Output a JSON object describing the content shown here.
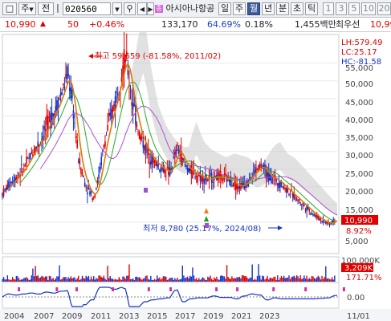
{
  "toolbar": {
    "mode_label": "주",
    "jeon_label": "전",
    "code_value": "020560",
    "stock_name": "아시아나항공",
    "periods": [
      "일",
      "주",
      "월",
      "년",
      "분",
      "초",
      "틱"
    ],
    "active_period": "월",
    "intervals": [
      "1",
      "3",
      "5",
      "10",
      "20"
    ]
  },
  "infobar": {
    "price": "10,990",
    "change": "50",
    "change_pct": "+0.46%",
    "volume": "133,170",
    "ratio": "64.69%",
    "turnover": "0.18%",
    "amount": "1,455백만",
    "best_label": "최우선",
    "best_value": "10,99"
  },
  "indicators": {
    "lh": "LH:579.49",
    "lc": "LC:25.17",
    "hc": "HC:-81.58"
  },
  "annotations": {
    "high": "최고 59,659 (-81.58%, 2011/02)",
    "low": "최저 8,780 (25.17%, 2024/08)"
  },
  "price_axis": {
    "labels": [
      "55,000",
      "50,000",
      "45,000",
      "40,000",
      "35,000",
      "30,000",
      "25,000",
      "20,000",
      "15,000",
      "5,000"
    ],
    "current_price": "10,990",
    "current_pct": "8.92%"
  },
  "volume_axis": {
    "top_label": "100,000K",
    "current_volume": "3,209K",
    "current_pct": "171.71%"
  },
  "oscillator_axis": {
    "zero_label": "0.00"
  },
  "date_axis": {
    "labels": [
      "2004",
      "2007",
      "2009",
      "2011",
      "2013",
      "2015",
      "2017",
      "2019",
      "2021",
      "2023"
    ],
    "corner_label": "11/01"
  },
  "colors": {
    "candle_up": "#e00000",
    "candle_down": "#1533c8",
    "ma_short": "#e07800",
    "ma_mid": "#2aa82a",
    "ma_long": "#b04ed6",
    "cloud": "#c8c8c8",
    "toolbar_bg": "#eef0f4"
  },
  "chart_data": {
    "type": "line",
    "title": "",
    "x": [
      2003.0,
      2003.5,
      2004.0,
      2004.5,
      2005.0,
      2005.5,
      2006.0,
      2006.5,
      2007.0,
      2007.3,
      2007.6,
      2008.0,
      2008.5,
      2009.0,
      2009.3,
      2009.6,
      2010.0,
      2010.5,
      2010.8,
      2011.1,
      2011.5,
      2012.0,
      2012.5,
      2013.0,
      2013.5,
      2014.0,
      2014.3,
      2014.5,
      2015.0,
      2015.5,
      2016.0,
      2016.5,
      2017.0,
      2017.5,
      2018.0,
      2018.5,
      2019.0,
      2019.5,
      2020.0,
      2020.5,
      2021.0,
      2021.5,
      2022.0,
      2022.5,
      2023.0,
      2023.5,
      2024.0,
      2024.5,
      2025.0
    ],
    "series": [
      {
        "values": [
          18000,
          21000,
          23000,
          26000,
          30000,
          33000,
          38000,
          42000,
          48000,
          52000,
          44000,
          28000,
          20000,
          17000,
          22000,
          30000,
          38000,
          46000,
          52000,
          57000,
          45000,
          35000,
          30000,
          27000,
          25000,
          24000,
          28000,
          31000,
          26000,
          24000,
          23000,
          22000,
          23000,
          22500,
          22000,
          20000,
          21000,
          24000,
          26000,
          23000,
          22000,
          20000,
          18000,
          16000,
          14000,
          12000,
          10500,
          9500,
          10990
        ]
      }
    ],
    "xlabel": "",
    "ylabel": "",
    "ylim": [
      2000,
      62000
    ],
    "grid": true,
    "legend": "none"
  }
}
